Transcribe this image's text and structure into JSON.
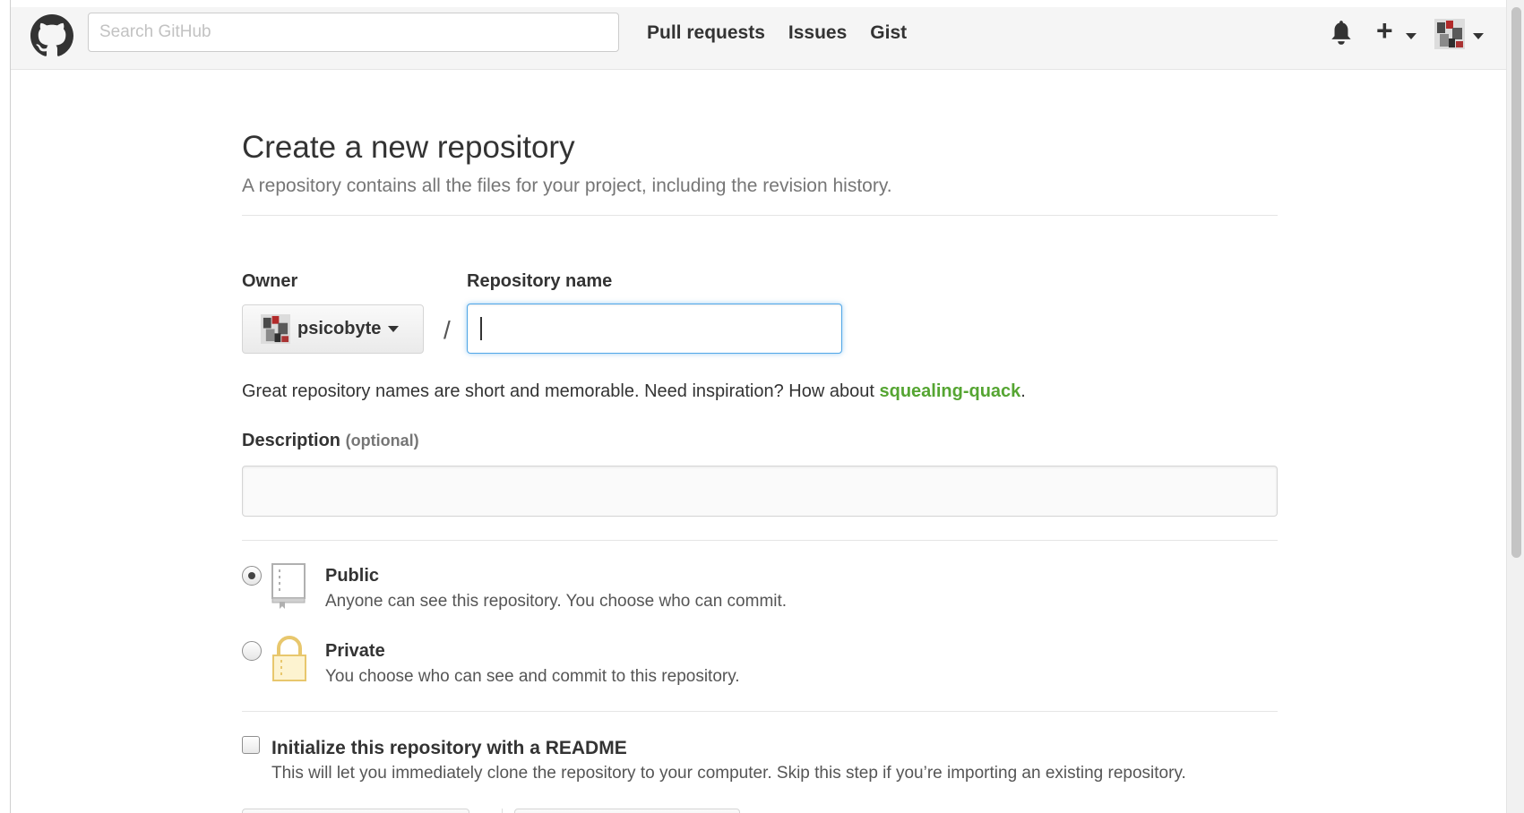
{
  "header": {
    "search_placeholder": "Search GitHub",
    "nav": [
      {
        "label": "Pull requests"
      },
      {
        "label": "Issues"
      },
      {
        "label": "Gist"
      }
    ],
    "icons": [
      "github-logo-icon",
      "bell-icon",
      "plus-icon",
      "avatar"
    ]
  },
  "main": {
    "title": "Create a new repository",
    "subtitle": "A repository contains all the files for your project, including the revision history.",
    "owner_label": "Owner",
    "owner_name": "psicobyte",
    "slash": "/",
    "repo_name_label": "Repository name",
    "repo_name_value": "",
    "hint_text": "Great repository names are short and memorable. Need inspiration? How about ",
    "hint_suggestion": "squealing-quack",
    "hint_end": ".",
    "description_label": "Description",
    "description_optional": "(optional)",
    "description_value": "",
    "visibility": {
      "selected": "public",
      "public": {
        "title": "Public",
        "desc": "Anyone can see this repository. You choose who can commit."
      },
      "private": {
        "title": "Private",
        "desc": "You choose who can see and commit to this repository."
      }
    },
    "readme": {
      "checked": false,
      "title": "Initialize this repository with a README",
      "desc": "This will let you immediately clone the repository to your computer. Skip this step if you’re importing an existing repository."
    }
  },
  "colors": {
    "accent_blue": "#51a7e8",
    "suggestion_green": "#55a532",
    "header_bg": "#f5f5f5",
    "private_lock": "#e8c76d"
  }
}
